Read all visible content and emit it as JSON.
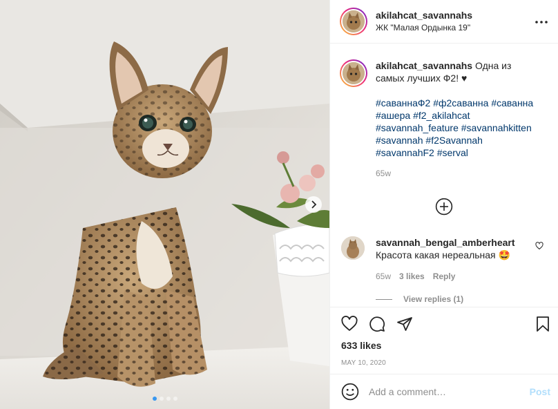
{
  "post": {
    "username": "akilahcat_savannahs",
    "location": "ЖК \"Малая Ордынка 19\"",
    "caption_text": "Одна из самых лучших Ф2! ♥",
    "hashtags": [
      "#саваннаФ2",
      "#ф2саванна",
      "#саванна",
      "#ашера",
      "#f2_akilahcat",
      "#savannah_feature",
      "#savannahkitten",
      "#savannah",
      "#f2Savannah",
      "#savannahF2",
      "#serval"
    ],
    "caption_time": "65w",
    "likes": "633 likes",
    "date": "MAY 10, 2020"
  },
  "carousel": {
    "total": 4,
    "active_index": 0
  },
  "comment": {
    "username": "savannah_bengal_amberheart",
    "text": "Красота какая нереальная 🤩",
    "time": "65w",
    "likes": "3 likes",
    "reply_label": "Reply",
    "view_replies": "View replies (1)"
  },
  "composer": {
    "placeholder": "Add a comment…",
    "post_label": "Post"
  },
  "icons": {
    "more": "more-options-icon",
    "like": "heart-icon",
    "comment": "comment-icon",
    "share": "paper-plane-icon",
    "save": "bookmark-icon",
    "emoji": "emoji-icon",
    "load_more": "plus-circle-icon",
    "next": "chevron-right-icon"
  },
  "colors": {
    "link": "#00376b",
    "muted": "#8e8e8e",
    "post_disabled": "#b2dffc",
    "dot_active": "#3897f0"
  }
}
